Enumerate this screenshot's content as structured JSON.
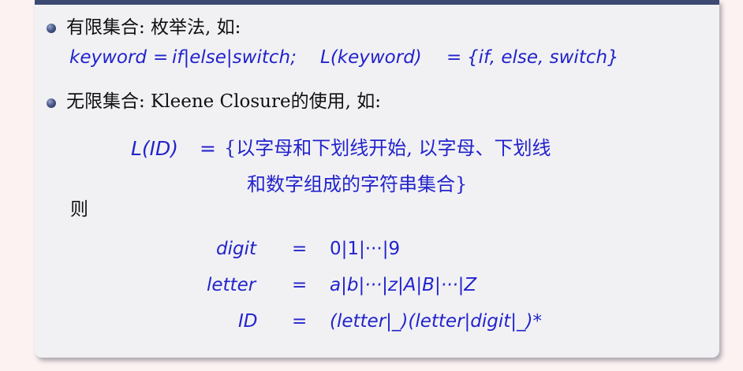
{
  "bullets": [
    {
      "title": "有限集合: 枚举法, 如:",
      "lhs1": "keyword",
      "eq1": "=",
      "rhs1": "if|else|switch;",
      "lhs2": "L(keyword)",
      "eq2": "=",
      "rhs2": "{if, else, switch}"
    },
    {
      "title": "无限集合: Kleene Closure的使用, 如:"
    }
  ],
  "id_definition": {
    "lhs": "L(ID)",
    "eq": "=",
    "line1": "{以字母和下划线开始, 以字母、下划线",
    "line2": "和数字组成的字符串集合}"
  },
  "then_label": "则",
  "equations": [
    {
      "lhs": "digit",
      "eq": "=",
      "rhs": "0|1|···|9"
    },
    {
      "lhs": "letter",
      "eq": "=",
      "rhs": "a|b|···|z|A|B|···|Z"
    },
    {
      "lhs": "ID",
      "eq": "=",
      "rhs": "(letter|_)(letter|digit|_)*"
    }
  ],
  "colors": {
    "background": "#fdf2f2",
    "box": "#f1f1f4",
    "header_bar": "#3c4a72",
    "math_blue": "#2323cc",
    "text": "#111111"
  }
}
